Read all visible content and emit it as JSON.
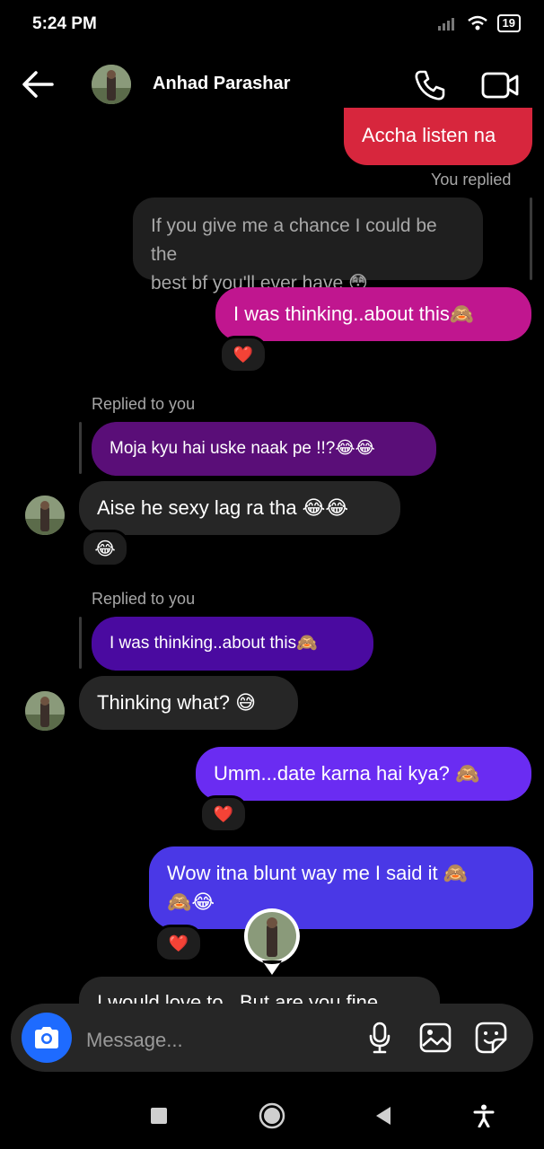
{
  "status_bar": {
    "time": "5:24 PM",
    "battery": "19"
  },
  "header": {
    "contact_name": "Anhad Parashar"
  },
  "messages": {
    "top_cut": "Accha listen na",
    "you_replied_label": "You replied",
    "quoted_1": "If you give me a chance I could be the best bf you'll ever have 😳",
    "quoted_1_line1": "If you give me a chance I could be the",
    "quoted_1_line2": "best bf you'll ever have 😳",
    "m1": "I was thinking..about this🙈",
    "m1_reaction": "❤️",
    "replied_to_you_1": "Replied to you",
    "reply_quote_1": "Moja kyu hai uske naak pe !!?😂😂",
    "m2": "Aise he sexy lag ra tha 😂😂",
    "m2_reaction": "😂",
    "replied_to_you_2": "Replied to you",
    "reply_quote_2": "I was thinking..about this🙈",
    "m3": "Thinking what? 😅",
    "m4": "Umm...date karna hai kya? 🙈",
    "m4_reaction": "❤️",
    "m5_line1": "Wow itna blunt way me I said it 🙈",
    "m5_line2": "🙈😂",
    "m5_reaction": "❤️",
    "bottom_cut": "I would love to.. But are you fine"
  },
  "composer": {
    "placeholder": "Message..."
  },
  "colors": {
    "red_bubble": "#d7263d",
    "magenta_bubble": "#c0168f",
    "purple_quote": "#5a0e78",
    "violet_quote": "#4a0aa0",
    "violet_bubble": "#6a2cf2",
    "blue_bubble": "#4a38e6",
    "gray_bubble": "#262626"
  }
}
